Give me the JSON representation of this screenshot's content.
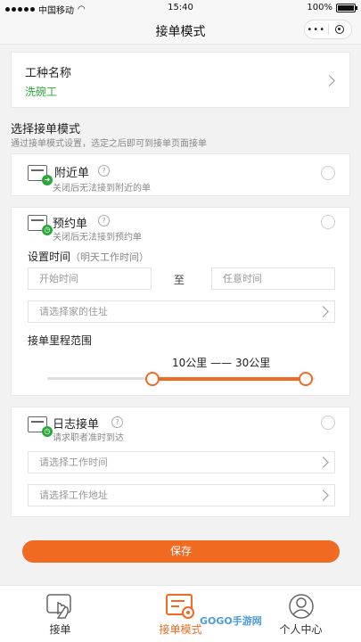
{
  "status_bar": {
    "carrier": "中国移动",
    "time": "15:40",
    "battery": "100%"
  },
  "nav": {
    "title": "接单模式",
    "more": "•••"
  },
  "job": {
    "label": "工种名称",
    "value": "洗碗工"
  },
  "mode_section": {
    "title": "选择接单模式",
    "desc": "通过接单模式设置，选定之后即可到接单页面接单"
  },
  "nearby": {
    "title": "附近单",
    "desc": "关闭后无法接到附近的单",
    "help": "?"
  },
  "booking": {
    "title": "预约单",
    "desc": "关闭后无法接到预约单",
    "help": "?",
    "time_label": "设置时间",
    "time_hint": "（明天工作时间）",
    "start_placeholder": "开始时间",
    "to": "至",
    "end_placeholder": "任意时间",
    "address_placeholder": "请选择家的住址",
    "range_label": "接单里程范围",
    "range_min": "10公里",
    "range_sep": "——",
    "range_max": "30公里",
    "range_value": [
      10,
      30
    ]
  },
  "daily": {
    "title": "日志接单",
    "desc": "请求职者准时到达",
    "help": "?",
    "time_placeholder": "请选择工作时间",
    "address_placeholder": "请选择工作地址"
  },
  "save_label": "保存",
  "tabs": [
    {
      "label": "接单",
      "icon": "hand-tap-icon",
      "active": false
    },
    {
      "label": "接单模式",
      "icon": "settings-doc-icon",
      "active": true
    },
    {
      "label": "个人中心",
      "icon": "user-icon",
      "active": false
    }
  ],
  "watermark": "GOGO手游网",
  "colors": {
    "accent": "#f06a22",
    "green": "#2aa83a"
  }
}
